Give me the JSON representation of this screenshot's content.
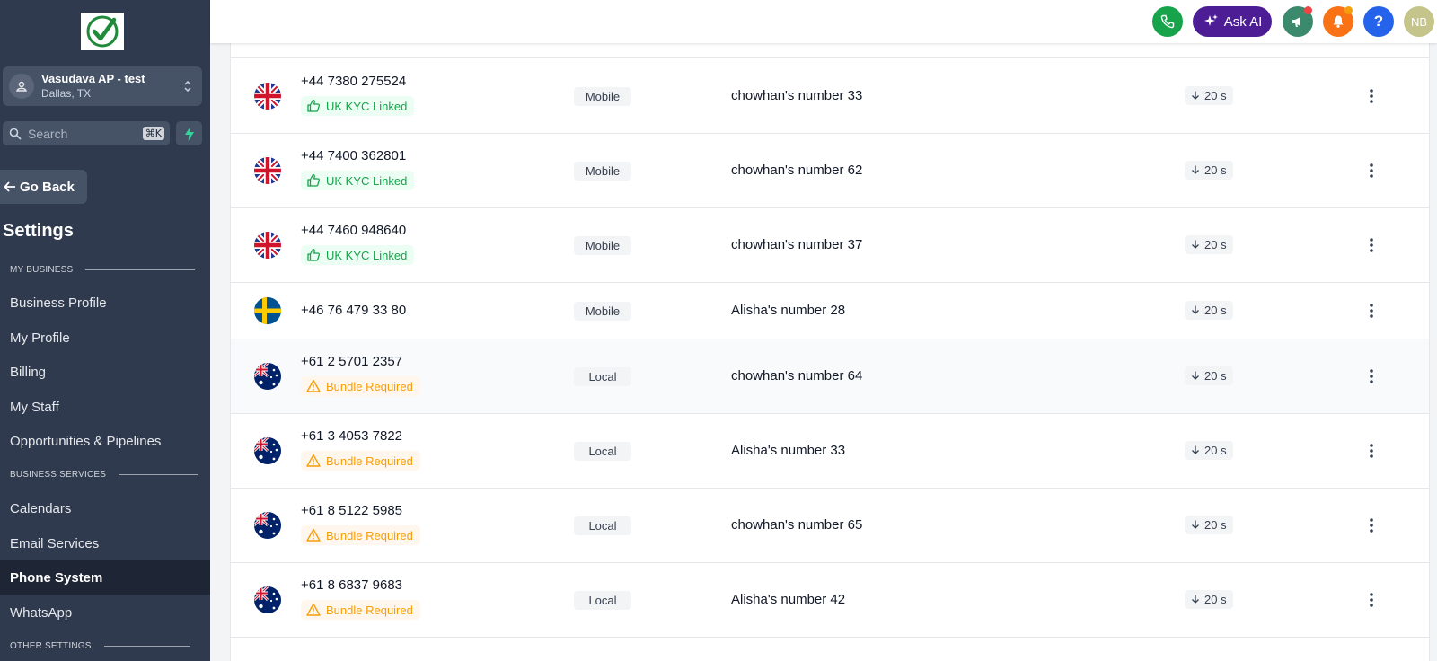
{
  "sidebar": {
    "account": {
      "name": "Vasudava AP - test",
      "location": "Dallas, TX"
    },
    "search": {
      "placeholder": "Search",
      "shortcut": "⌘K"
    },
    "go_back": "Go Back",
    "title": "Settings",
    "sections": [
      {
        "label": "MY BUSINESS"
      },
      {
        "label": "BUSINESS SERVICES"
      },
      {
        "label": "OTHER SETTINGS"
      }
    ],
    "items": [
      {
        "label": "Business Profile"
      },
      {
        "label": "My Profile"
      },
      {
        "label": "Billing"
      },
      {
        "label": "My Staff"
      },
      {
        "label": "Opportunities & Pipelines"
      },
      {
        "label": "Calendars"
      },
      {
        "label": "Email Services"
      },
      {
        "label": "Phone System",
        "active": true
      },
      {
        "label": "WhatsApp"
      }
    ]
  },
  "topbar": {
    "ask_ai": "Ask AI",
    "help": "?",
    "avatar_initials": "NB",
    "colors": {
      "phone": "#16a34a",
      "ask_ai": "#4c1d95",
      "megaphone": "#3b8a6e",
      "bell": "#f97316",
      "help": "#2563eb",
      "avatar": "#c5c48a"
    }
  },
  "numbers": [
    {
      "phone": "+44 7380 275524",
      "badge": "UK KYC Linked",
      "badge_kind": "green",
      "flag": "uk",
      "type": "Mobile",
      "name": "chowhan's number 33",
      "ring": "20 s"
    },
    {
      "phone": "+44 7400 362801",
      "badge": "UK KYC Linked",
      "badge_kind": "green",
      "flag": "uk",
      "type": "Mobile",
      "name": "chowhan's number 62",
      "ring": "20 s"
    },
    {
      "phone": "+44 7460 948640",
      "badge": "UK KYC Linked",
      "badge_kind": "green",
      "flag": "uk",
      "type": "Mobile",
      "name": "chowhan's number 37",
      "ring": "20 s"
    },
    {
      "phone": "+46 76 479 33 80",
      "badge": "",
      "badge_kind": "",
      "flag": "se",
      "type": "Mobile",
      "name": "Alisha's number 28",
      "ring": "20 s"
    },
    {
      "phone": "+61 2 5701 2357",
      "badge": "Bundle Required",
      "badge_kind": "orange",
      "flag": "au",
      "type": "Local",
      "name": "chowhan's number 64",
      "ring": "20 s"
    },
    {
      "phone": "+61 3 4053 7822",
      "badge": "Bundle Required",
      "badge_kind": "orange",
      "flag": "au",
      "type": "Local",
      "name": "Alisha's number 33",
      "ring": "20 s"
    },
    {
      "phone": "+61 8 5122 5985",
      "badge": "Bundle Required",
      "badge_kind": "orange",
      "flag": "au",
      "type": "Local",
      "name": "chowhan's number 65",
      "ring": "20 s"
    },
    {
      "phone": "+61 8 6837 9683",
      "badge": "Bundle Required",
      "badge_kind": "orange",
      "flag": "au",
      "type": "Local",
      "name": "Alisha's number 42",
      "ring": "20 s"
    }
  ]
}
